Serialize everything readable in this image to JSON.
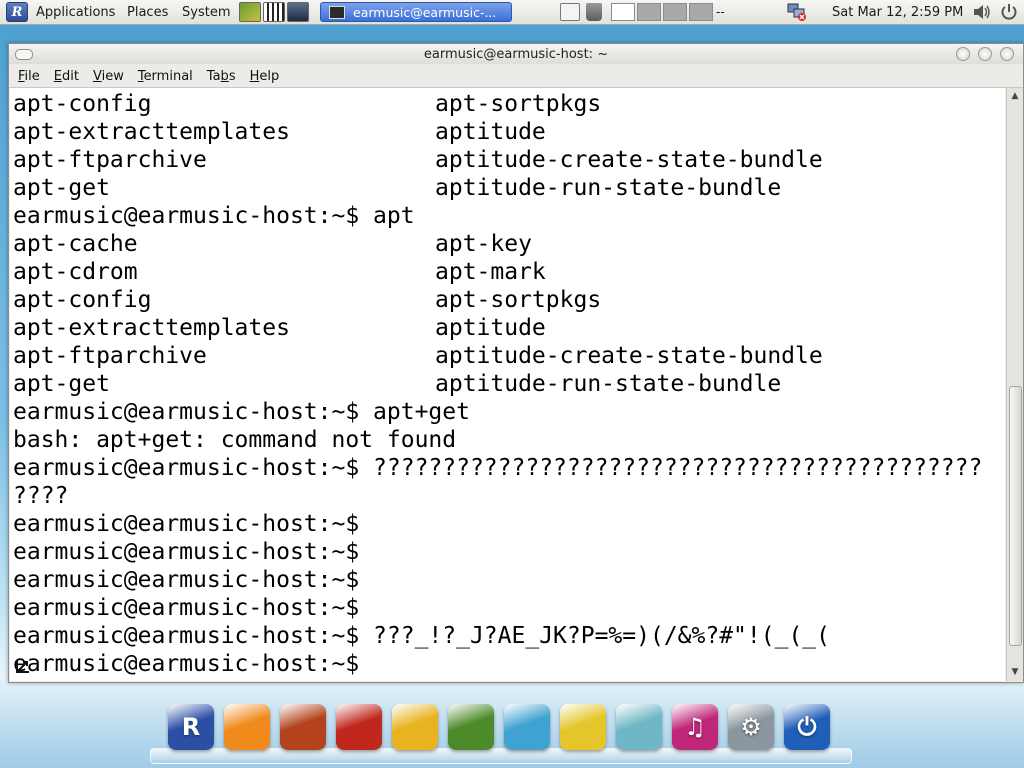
{
  "top_panel": {
    "menus": [
      "Applications",
      "Places",
      "System"
    ],
    "task": {
      "label": "earmusic@earmusic-..."
    },
    "workspace_sep": "--",
    "clock": "Sat Mar 12,  2:59 PM",
    "icons": {
      "menu_logo": "R",
      "launchers": [
        "settings-launcher-icon",
        "piano-launcher-icon",
        "monitor-launcher-icon"
      ],
      "tray": [
        "notes-icon",
        "trash-icon",
        "network-disconnected-icon",
        "volume-icon",
        "power-icon"
      ]
    }
  },
  "window": {
    "title": "earmusic@earmusic-host: ~",
    "menu": [
      {
        "label": "File",
        "mnemonic": "F",
        "rest": "ile"
      },
      {
        "label": "Edit",
        "mnemonic": "E",
        "rest": "dit"
      },
      {
        "label": "View",
        "mnemonic": "V",
        "rest": "iew"
      },
      {
        "label": "Terminal",
        "mnemonic": "T",
        "rest": "erminal"
      },
      {
        "label": "Tabs",
        "mnemonic": "b",
        "rest_before": "Ta",
        "rest": "s"
      },
      {
        "label": "Help",
        "mnemonic": "H",
        "rest": "elp"
      }
    ]
  },
  "terminal": {
    "lines": [
      {
        "c1": "apt-config",
        "c2": "apt-sortpkgs"
      },
      {
        "c1": "apt-extracttemplates",
        "c2": "aptitude"
      },
      {
        "c1": "apt-ftparchive",
        "c2": "aptitude-create-state-bundle"
      },
      {
        "c1": "apt-get",
        "c2": "aptitude-run-state-bundle"
      },
      {
        "c1": "earmusic@earmusic-host:~$ apt",
        "c2": ""
      },
      {
        "c1": "apt-cache",
        "c2": "apt-key"
      },
      {
        "c1": "apt-cdrom",
        "c2": "apt-mark"
      },
      {
        "c1": "apt-config",
        "c2": "apt-sortpkgs"
      },
      {
        "c1": "apt-extracttemplates",
        "c2": "aptitude"
      },
      {
        "c1": "apt-ftparchive",
        "c2": "aptitude-create-state-bundle"
      },
      {
        "c1": "apt-get",
        "c2": "aptitude-run-state-bundle"
      },
      {
        "c1": "earmusic@earmusic-host:~$ apt+get",
        "c2": ""
      },
      {
        "c1": "bash: apt+get: command not found",
        "c2": ""
      },
      {
        "c1": "earmusic@earmusic-host:~$ ????????????????????????????????????????????",
        "c2": ""
      },
      {
        "c1": "????",
        "c2": ""
      },
      {
        "c1": "earmusic@earmusic-host:~$",
        "c2": ""
      },
      {
        "c1": "earmusic@earmusic-host:~$",
        "c2": ""
      },
      {
        "c1": "earmusic@earmusic-host:~$",
        "c2": ""
      },
      {
        "c1": "earmusic@earmusic-host:~$",
        "c2": ""
      },
      {
        "c1": "earmusic@earmusic-host:~$ ???_!?_J?AE_JK?P=%=)(/&%?#\"!(_(_(",
        "c2": ""
      },
      {
        "c1": "earmusic@earmusic-host:~$",
        "c2": ""
      }
    ]
  },
  "dock": {
    "items": [
      {
        "name": "dock-r-logo-icon",
        "glyph": "R",
        "color": "#2c4fa6"
      },
      {
        "name": "dock-browser-icon",
        "glyph": "",
        "color": "#f08a1c"
      },
      {
        "name": "dock-guitar-icon",
        "glyph": "",
        "color": "#b4431d"
      },
      {
        "name": "dock-media-icon",
        "glyph": "",
        "color": "#c0281e"
      },
      {
        "name": "dock-coffee-icon",
        "glyph": "",
        "color": "#e8b321"
      },
      {
        "name": "dock-photo-icon",
        "glyph": "",
        "color": "#4c8a2a"
      },
      {
        "name": "dock-messenger-icon",
        "glyph": "",
        "color": "#3fa2d0"
      },
      {
        "name": "dock-folder-icon",
        "glyph": "",
        "color": "#e4c62a"
      },
      {
        "name": "dock-editor-icon",
        "glyph": "",
        "color": "#6fb7c6"
      },
      {
        "name": "dock-music-icon",
        "glyph": "♫",
        "color": "#c0277a"
      },
      {
        "name": "dock-settings-icon",
        "glyph": "⚙",
        "color": "#8c969e"
      },
      {
        "name": "dock-power-icon",
        "glyph": "⏻",
        "color": "#1f5fb8"
      }
    ]
  }
}
